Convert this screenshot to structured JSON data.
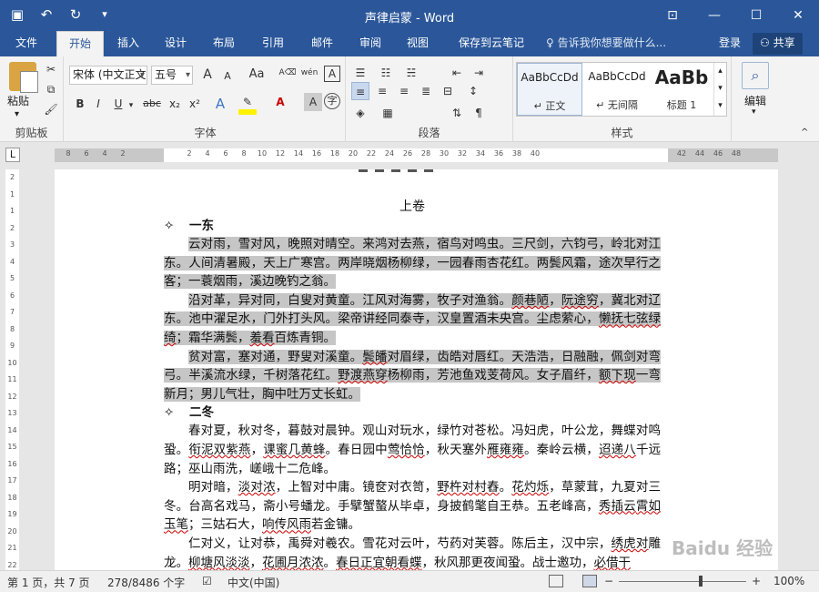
{
  "window": {
    "title": "声律启蒙 - Word",
    "qat_icons": [
      "save-icon",
      "undo-icon",
      "redo-icon",
      "customize-qat-icon"
    ],
    "controls": [
      "ribbon-display-icon",
      "minimize-icon",
      "maximize-icon",
      "close-icon"
    ]
  },
  "tabs": [
    "文件",
    "开始",
    "插入",
    "设计",
    "布局",
    "引用",
    "邮件",
    "审阅",
    "视图",
    "保存到云笔记"
  ],
  "active_tab": "开始",
  "tell_me": "告诉我你想要做什么...",
  "login": "登录",
  "share": "共享",
  "ribbon": {
    "clipboard": {
      "label": "剪贴板",
      "paste": "粘贴"
    },
    "font": {
      "label": "字体",
      "font_name": "宋体 (中文正文",
      "font_size": "五号",
      "buttons": [
        "B",
        "I",
        "U",
        "abc",
        "x₂",
        "x²"
      ],
      "grow": "A",
      "shrink": "A",
      "case": "Aa",
      "phonetic": "wén",
      "border": "A",
      "clear": "A"
    },
    "paragraph": {
      "label": "段落"
    },
    "styles": {
      "label": "样式",
      "items": [
        {
          "preview": "AaBbCcDd",
          "name": "↵ 正文"
        },
        {
          "preview": "AaBbCcDd",
          "name": "↵ 无间隔"
        },
        {
          "preview": "AaBb",
          "name": "标题 1"
        }
      ]
    },
    "editing": {
      "label": "编辑"
    }
  },
  "ruler": {
    "corner": "L",
    "h_ticks": [
      "8",
      "6",
      "4",
      "2",
      "2",
      "4",
      "6",
      "8",
      "10",
      "12",
      "14",
      "16",
      "18",
      "20",
      "22",
      "24",
      "26",
      "28",
      "30",
      "32",
      "34",
      "36",
      "38",
      "40",
      "42",
      "44",
      "46",
      "48"
    ],
    "v_ticks": [
      "2",
      "1",
      "1",
      "2",
      "3",
      "4",
      "5",
      "6",
      "7",
      "8",
      "9",
      "10",
      "11",
      "12",
      "13",
      "14",
      "15",
      "16",
      "17",
      "18",
      "19",
      "20",
      "21",
      "22"
    ]
  },
  "document": {
    "volume_title": "上卷",
    "sections": [
      {
        "heading": "一东",
        "bullet": "✧",
        "highlighted": true,
        "paragraphs": [
          [
            "云对雨，雪对风，晚照对晴空。来鸿对去燕，宿鸟对鸣虫。三尺剑，六钧弓，岭北对",
            "江东。人间清暑殿，天上广寒宫。两岸晓烟杨柳绿，一园春雨杏花红。两鬓风霜，途次早",
            "行之客；一蓑烟雨，溪边晚钓之翁。"
          ],
          [
            "沿对革，异对同，白叟对黄童。江风对海雾，牧子对渔翁。颜巷陋，阮途穷，冀北对",
            "辽东。池中濯足水，门外打头风。梁帝讲经同泰寺，汉皇置酒未央宫。尘虑萦心，懒抚七",
            "弦绿绮；霜华满鬓，羞看百炼青铜。"
          ],
          [
            "贫对富，塞对通，野叟对溪童。鬓皤对眉绿，齿皓对唇红。天浩浩，日融融，佩剑对",
            "弯弓。半溪流水绿，千树落花红。野渡燕穿杨柳雨，芳池鱼戏芰荷风。女子眉纤，额下现",
            "一弯新月；男儿气壮，胸中吐万丈长虹。"
          ]
        ]
      },
      {
        "heading": "二冬",
        "bullet": "✧",
        "highlighted": false,
        "paragraphs": [
          [
            "春对夏，秋对冬，暮鼓对晨钟。观山对玩水，绿竹对苍松。冯妇虎，叶公龙，舞蝶对",
            "鸣蛩。衔泥双紫燕，课蜜几黄蜂。春日园中莺恰恰，秋天塞外雁雍雍。秦岭云横，迢递八",
            "千远路；巫山雨洗，嵯峨十二危峰。"
          ],
          [
            "明对暗，淡对浓，上智对中庸。镜奁对衣笥，野杵对村舂。花灼烁，草蒙茸，九夏对",
            "三冬。台高名戏马，斋小号蟠龙。手擘蟹螯从毕卓，身披鹤氅自王恭。五老峰高，秀插云",
            "霄如玉笔；三姑石大，响传风雨若金镛。"
          ],
          [
            "仁对义，让对恭，禹舜对羲农。雪花对云叶，芍药对芙蓉。陈后主，汉中宗，绣虎对",
            "雕龙。柳塘风淡淡，花圃月浓浓。春日正宜朝看蝶，秋风那更夜闻蛩。战士邀功，必借干"
          ]
        ]
      }
    ]
  },
  "status": {
    "page": "第 1 页，共 7 页",
    "words": "278/8486 个字",
    "language": "中文(中国)",
    "zoom": "100%"
  },
  "watermark": "Baidu 经验"
}
